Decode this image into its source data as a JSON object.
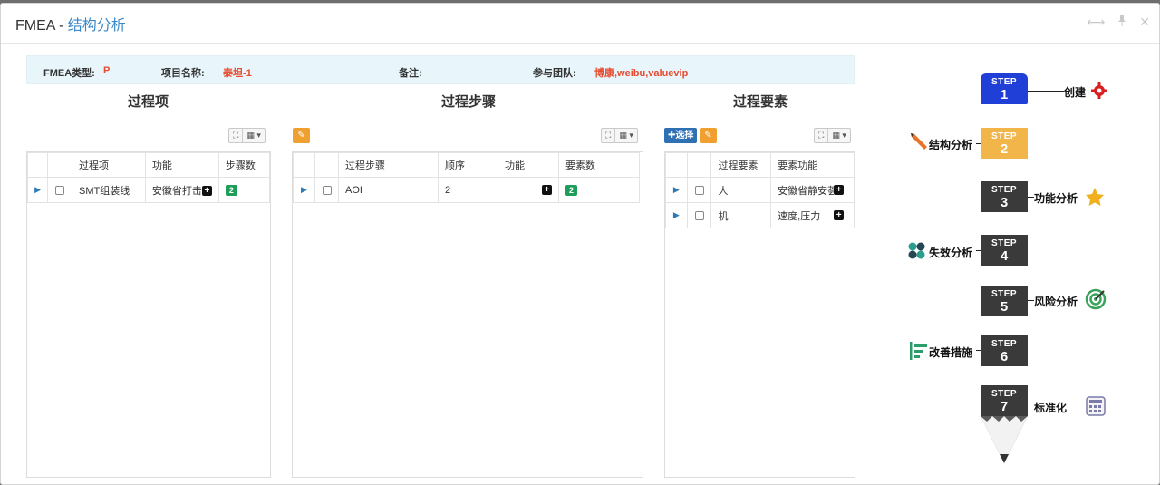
{
  "window": {
    "title_prefix": "FMEA - ",
    "title_sub": "结构分析"
  },
  "header_tools": [
    "⟷",
    "📌",
    "✕"
  ],
  "info": {
    "fmea_type_label": "FMEA类型:",
    "fmea_type_value": "P",
    "project_label": "项目名称:",
    "project_value": "泰坦-1",
    "note_label": "备注:",
    "team_label": "参与团队:",
    "team_value": "博康,weibu,valuevip"
  },
  "sections": {
    "process_item": "过程项",
    "process_step": "过程步骤",
    "process_element": "过程要素"
  },
  "toolbar": {
    "fullscreen_icon": "⛶",
    "columns_icon": "▦",
    "caret_icon": "▾",
    "edit_icon": "✎",
    "select_label": "✚选择"
  },
  "process_items": {
    "columns": [
      "过程项",
      "功能",
      "步骤数"
    ],
    "rows": [
      {
        "name": "SMT组装线",
        "function": "安徽省打击",
        "count": "2"
      }
    ]
  },
  "process_steps": {
    "columns": [
      "过程步骤",
      "顺序",
      "功能",
      "要素数"
    ],
    "rows": [
      {
        "name": "AOI",
        "order": "2",
        "function": "",
        "count": "2"
      }
    ]
  },
  "process_elements": {
    "columns": [
      "过程要素",
      "要素功能"
    ],
    "rows": [
      {
        "name": "人",
        "function": "安徽省静安荟"
      },
      {
        "name": "机",
        "function": "速度,压力"
      }
    ]
  },
  "steps": [
    {
      "word": "STEP",
      "num": "1",
      "label": "创建",
      "color": "#1f3fd6",
      "icon": "gear-icon"
    },
    {
      "word": "STEP",
      "num": "2",
      "label": "结构分析",
      "color": "#f2b54a",
      "icon": "pencil-icon"
    },
    {
      "word": "STEP",
      "num": "3",
      "label": "功能分析",
      "color": "#3a3a3a",
      "icon": "star-icon"
    },
    {
      "word": "STEP",
      "num": "4",
      "label": "失效分析",
      "color": "#3a3a3a",
      "icon": "cluster-icon"
    },
    {
      "word": "STEP",
      "num": "5",
      "label": "风险分析",
      "color": "#3a3a3a",
      "icon": "target-icon"
    },
    {
      "word": "STEP",
      "num": "6",
      "label": "改善措施",
      "color": "#3a3a3a",
      "icon": "bars-icon"
    },
    {
      "word": "STEP",
      "num": "7",
      "label": "标准化",
      "color": "#3a3a3a",
      "icon": "calculator-icon"
    }
  ]
}
